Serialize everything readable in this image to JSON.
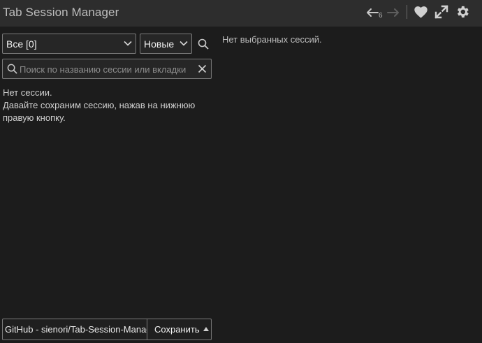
{
  "header": {
    "title": "Tab Session Manager",
    "undo_count": "6",
    "icons": [
      "undo-icon",
      "redo-icon",
      "heart-icon",
      "expand-icon",
      "gear-icon"
    ]
  },
  "filter": {
    "selected": "Все [0]",
    "sort_selected": "Новые"
  },
  "search": {
    "placeholder": "Поиск по названию сессии или вкладки",
    "value": ""
  },
  "sessions": {
    "empty_line1": "Нет сессии.",
    "empty_line2": "Давайте сохраним сессию, нажав на нижнюю правую кнопку."
  },
  "details": {
    "empty": "Нет выбранных сессий."
  },
  "save": {
    "name_value": "GitHub - sienori/Tab-Session-Manager",
    "button_label": "Сохранить"
  },
  "colors": {
    "background": "#1c1c1c",
    "header": "#2d2d2d",
    "border": "#7a7a7a",
    "text": "#d8d8d8"
  }
}
